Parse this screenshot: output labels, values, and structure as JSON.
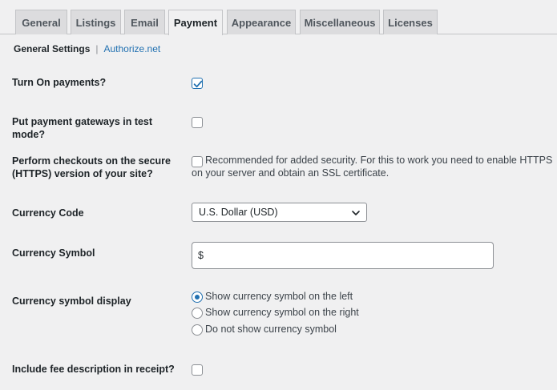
{
  "tabs": [
    {
      "label": "General"
    },
    {
      "label": "Listings"
    },
    {
      "label": "Email"
    },
    {
      "label": "Payment",
      "active": true
    },
    {
      "label": "Appearance"
    },
    {
      "label": "Miscellaneous"
    },
    {
      "label": "Licenses"
    }
  ],
  "subnav": {
    "current": "General Settings",
    "separator": "|",
    "link": "Authorize.net"
  },
  "settings": {
    "turn_on_payments": {
      "label": "Turn On payments?",
      "checked": true
    },
    "test_mode": {
      "label": "Put payment gateways in test mode?",
      "checked": false
    },
    "secure_checkout": {
      "label_line1": "Perform checkouts on the secure",
      "label_line2": "(HTTPS) version of your site?",
      "checked": false,
      "description_line1": "Recommended for added security. For this to work you need to enable HTTPS",
      "description_line2": "on your server and obtain an SSL certificate."
    },
    "currency_code": {
      "label": "Currency Code",
      "selected": "U.S. Dollar (USD)"
    },
    "currency_symbol": {
      "label": "Currency Symbol",
      "value": "$"
    },
    "currency_display": {
      "label": "Currency symbol display",
      "options": [
        {
          "label": "Show currency symbol on the left",
          "checked": true
        },
        {
          "label": "Show currency symbol on the right",
          "checked": false
        },
        {
          "label": "Do not show currency symbol",
          "checked": false
        }
      ]
    },
    "fee_description": {
      "label": "Include fee description in receipt?",
      "checked": false
    }
  },
  "colors": {
    "accent": "#2271b1",
    "background": "#f0f0f1"
  }
}
